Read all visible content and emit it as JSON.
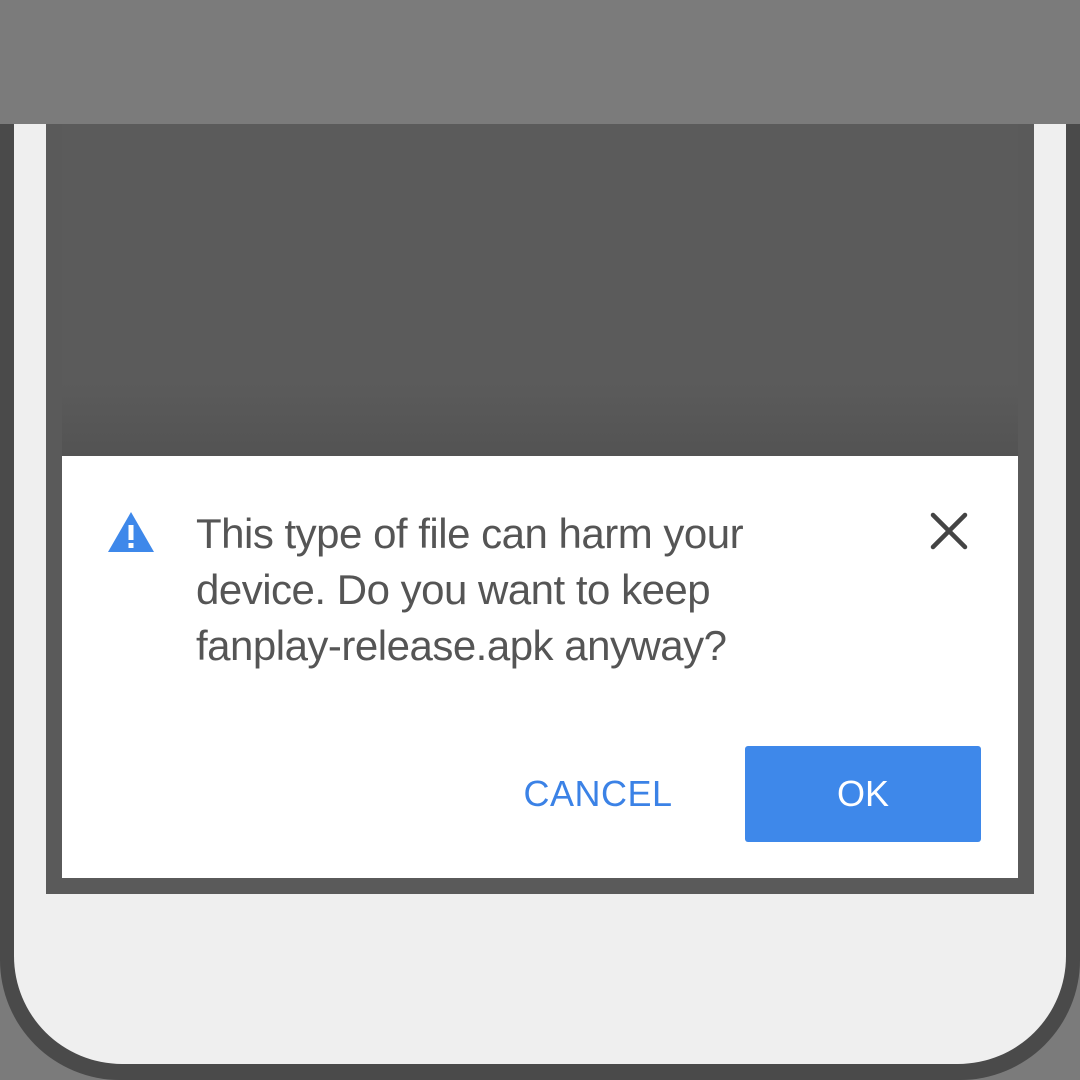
{
  "dialog": {
    "message": "This type of file can harm your device. Do you want to keep fanplay-release.apk anyway?",
    "cancel_label": "CANCEL",
    "ok_label": "OK",
    "icons": {
      "warning": "warning-triangle-icon",
      "close": "close-icon"
    }
  },
  "colors": {
    "accent": "#3e88ea",
    "text_link": "#3b82e6",
    "warning_icon": "#3e88ea",
    "message_text": "#555555"
  }
}
